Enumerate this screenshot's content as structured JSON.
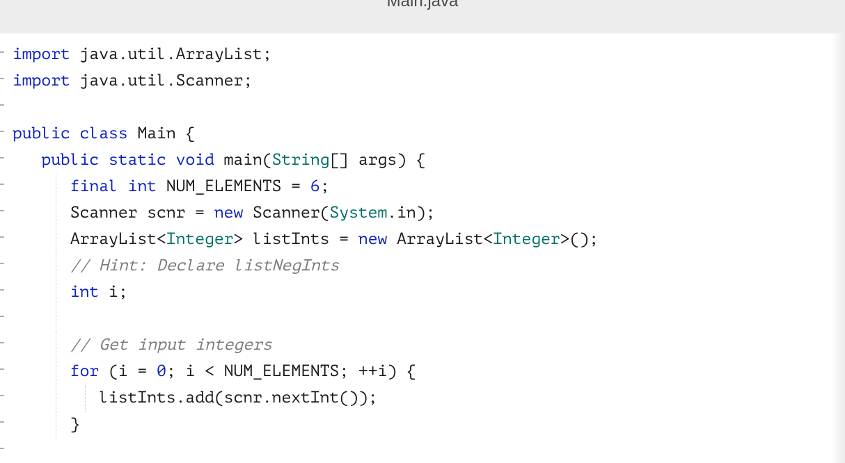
{
  "tab": {
    "filename": "Main.java"
  },
  "code": {
    "lines": [
      {
        "indent": 0,
        "guides": [],
        "tokens": [
          {
            "c": "kw",
            "t": "import"
          },
          {
            "c": "id",
            "t": " java"
          },
          {
            "c": "punct",
            "t": "."
          },
          {
            "c": "id",
            "t": "util"
          },
          {
            "c": "punct",
            "t": "."
          },
          {
            "c": "id",
            "t": "ArrayList"
          },
          {
            "c": "punct",
            "t": ";"
          }
        ]
      },
      {
        "indent": 0,
        "guides": [],
        "tokens": [
          {
            "c": "kw",
            "t": "import"
          },
          {
            "c": "id",
            "t": " java"
          },
          {
            "c": "punct",
            "t": "."
          },
          {
            "c": "id",
            "t": "util"
          },
          {
            "c": "punct",
            "t": "."
          },
          {
            "c": "id",
            "t": "Scanner"
          },
          {
            "c": "punct",
            "t": ";"
          }
        ]
      },
      {
        "indent": 0,
        "guides": [],
        "tokens": []
      },
      {
        "indent": 0,
        "guides": [],
        "tokens": [
          {
            "c": "kw",
            "t": "public"
          },
          {
            "c": "id",
            "t": " "
          },
          {
            "c": "kw",
            "t": "class"
          },
          {
            "c": "id",
            "t": " Main "
          },
          {
            "c": "punct",
            "t": "{"
          }
        ]
      },
      {
        "indent": 3,
        "guides": [],
        "tokens": [
          {
            "c": "kw",
            "t": "public"
          },
          {
            "c": "id",
            "t": " "
          },
          {
            "c": "kw",
            "t": "static"
          },
          {
            "c": "id",
            "t": " "
          },
          {
            "c": "kw",
            "t": "void"
          },
          {
            "c": "id",
            "t": " main"
          },
          {
            "c": "punct",
            "t": "("
          },
          {
            "c": "type",
            "t": "String"
          },
          {
            "c": "punct",
            "t": "[]"
          },
          {
            "c": "id",
            "t": " args"
          },
          {
            "c": "punct",
            "t": ") {"
          }
        ]
      },
      {
        "indent": 6,
        "guides": [
          62
        ],
        "tokens": [
          {
            "c": "kw",
            "t": "final"
          },
          {
            "c": "id",
            "t": " "
          },
          {
            "c": "kw",
            "t": "int"
          },
          {
            "c": "id",
            "t": " NUM_ELEMENTS "
          },
          {
            "c": "punct",
            "t": "="
          },
          {
            "c": "id",
            "t": " "
          },
          {
            "c": "num",
            "t": "6"
          },
          {
            "c": "punct",
            "t": ";"
          }
        ]
      },
      {
        "indent": 6,
        "guides": [
          62
        ],
        "tokens": [
          {
            "c": "id",
            "t": "Scanner scnr "
          },
          {
            "c": "punct",
            "t": "="
          },
          {
            "c": "id",
            "t": " "
          },
          {
            "c": "kw",
            "t": "new"
          },
          {
            "c": "id",
            "t": " Scanner"
          },
          {
            "c": "punct",
            "t": "("
          },
          {
            "c": "type",
            "t": "System"
          },
          {
            "c": "punct",
            "t": "."
          },
          {
            "c": "id",
            "t": "in"
          },
          {
            "c": "punct",
            "t": ");"
          }
        ]
      },
      {
        "indent": 6,
        "guides": [
          62
        ],
        "tokens": [
          {
            "c": "id",
            "t": "ArrayList"
          },
          {
            "c": "punct",
            "t": "<"
          },
          {
            "c": "type",
            "t": "Integer"
          },
          {
            "c": "punct",
            "t": ">"
          },
          {
            "c": "id",
            "t": " listInts "
          },
          {
            "c": "punct",
            "t": "="
          },
          {
            "c": "id",
            "t": " "
          },
          {
            "c": "kw",
            "t": "new"
          },
          {
            "c": "id",
            "t": " ArrayList"
          },
          {
            "c": "punct",
            "t": "<"
          },
          {
            "c": "type",
            "t": "Integer"
          },
          {
            "c": "punct",
            "t": ">();"
          }
        ]
      },
      {
        "indent": 6,
        "guides": [
          62
        ],
        "tokens": [
          {
            "c": "cmt",
            "t": "// Hint: Declare listNegInts"
          }
        ]
      },
      {
        "indent": 6,
        "guides": [
          62
        ],
        "tokens": [
          {
            "c": "kw",
            "t": "int"
          },
          {
            "c": "id",
            "t": " i"
          },
          {
            "c": "punct",
            "t": ";"
          }
        ]
      },
      {
        "indent": 6,
        "guides": [
          62
        ],
        "tokens": []
      },
      {
        "indent": 6,
        "guides": [
          62
        ],
        "tokens": [
          {
            "c": "cmt",
            "t": "// Get input integers"
          }
        ]
      },
      {
        "indent": 6,
        "guides": [
          62
        ],
        "tokens": [
          {
            "c": "kw",
            "t": "for"
          },
          {
            "c": "id",
            "t": " "
          },
          {
            "c": "punct",
            "t": "("
          },
          {
            "c": "id",
            "t": "i "
          },
          {
            "c": "punct",
            "t": "="
          },
          {
            "c": "id",
            "t": " "
          },
          {
            "c": "num",
            "t": "0"
          },
          {
            "c": "punct",
            "t": ";"
          },
          {
            "c": "id",
            "t": " i "
          },
          {
            "c": "punct",
            "t": "<"
          },
          {
            "c": "id",
            "t": " NUM_ELEMENTS"
          },
          {
            "c": "punct",
            "t": ";"
          },
          {
            "c": "id",
            "t": " "
          },
          {
            "c": "punct",
            "t": "++"
          },
          {
            "c": "id",
            "t": "i"
          },
          {
            "c": "punct",
            "t": ") {"
          }
        ]
      },
      {
        "indent": 9,
        "guides": [
          62,
          104
        ],
        "tokens": [
          {
            "c": "id",
            "t": "listInts"
          },
          {
            "c": "punct",
            "t": "."
          },
          {
            "c": "id",
            "t": "add"
          },
          {
            "c": "punct",
            "t": "("
          },
          {
            "c": "id",
            "t": "scnr"
          },
          {
            "c": "punct",
            "t": "."
          },
          {
            "c": "id",
            "t": "nextInt"
          },
          {
            "c": "punct",
            "t": "());"
          }
        ]
      },
      {
        "indent": 6,
        "guides": [
          62
        ],
        "tokens": [
          {
            "c": "punct",
            "t": "}"
          }
        ]
      }
    ]
  }
}
